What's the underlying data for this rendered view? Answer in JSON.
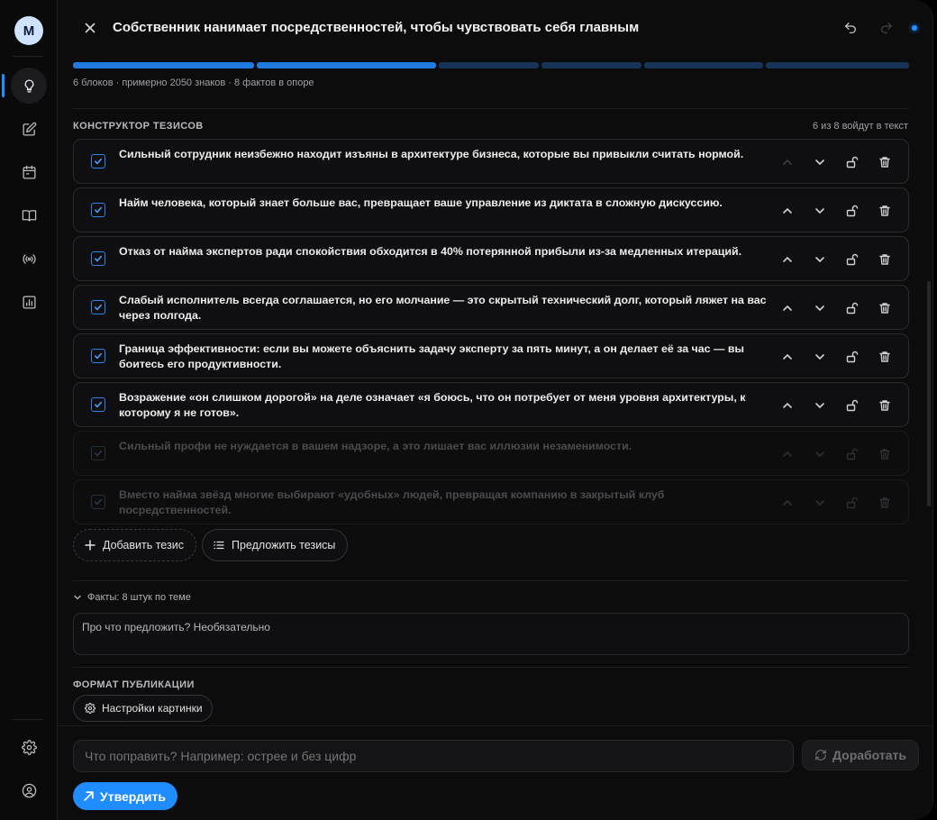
{
  "user": {
    "avatar_letter": "M"
  },
  "rail": {
    "items": [
      {
        "name": "ideas",
        "icon": "lightbulb-icon",
        "active": true
      },
      {
        "name": "editor",
        "icon": "pencil-square-icon",
        "active": false
      },
      {
        "name": "calendar",
        "icon": "calendar-icon",
        "active": false
      },
      {
        "name": "library",
        "icon": "book-icon",
        "active": false
      },
      {
        "name": "broadcast",
        "icon": "broadcast-icon",
        "active": false
      },
      {
        "name": "analytics",
        "icon": "bar-chart-icon",
        "active": false
      }
    ],
    "bottom": [
      {
        "name": "settings",
        "icon": "gear-icon"
      },
      {
        "name": "profile",
        "icon": "user-circle-icon"
      }
    ]
  },
  "header": {
    "title": "Собственник нанимает посредственностей, чтобы чувствовать себя главным",
    "accent_color": "#1e90ff"
  },
  "progress": {
    "segments": [
      {
        "status": "done"
      },
      {
        "status": "done"
      },
      {
        "status": "pending"
      },
      {
        "status": "pending"
      },
      {
        "status": "pending"
      },
      {
        "status": "pending"
      }
    ],
    "summary": "6 блоков · примерно 2050 знаков · 8 фактов в опоре"
  },
  "constructor": {
    "label": "КОНСТРУКТОР ТЕЗИСОВ",
    "counter": "6 из 8 войдут в текст",
    "theses": [
      {
        "text": "Сильный сотрудник неизбежно находит изъяны в архитектуре бизнеса, которые вы привыкли считать нормой.",
        "checked": true,
        "up_enabled": false
      },
      {
        "text": "Найм человека, который знает больше вас, превращает ваше управление из диктата в сложную дискуссию.",
        "checked": true,
        "up_enabled": true
      },
      {
        "text": "Отказ от найма экспертов ради спокойствия обходится в 40% потерянной прибыли из-за медленных итераций.",
        "checked": true,
        "up_enabled": true
      },
      {
        "text": "Слабый исполнитель всегда соглашается, но его молчание — это скрытый технический долг, который ляжет на вас через полгода.",
        "checked": true,
        "up_enabled": true
      },
      {
        "text": "Граница эффективности: если вы можете объяснить задачу эксперту за пять минут, а он делает её за час — вы боитесь его продуктивности.",
        "checked": true,
        "up_enabled": true
      },
      {
        "text": "Возражение «он слишком дорогой» на деле означает «я боюсь, что он потребует от меня уровня архитектуры, к которому я не готов».",
        "checked": true,
        "up_enabled": true
      },
      {
        "text": "Сильный профи не нуждается в вашем надзоре, а это лишает вас иллюзии незаменимости.",
        "checked": false,
        "up_enabled": true
      },
      {
        "text": "Вместо найма звёзд многие выбирают «удобных» людей, превращая компанию в закрытый клуб посредственностей.",
        "checked": false,
        "up_enabled": true
      }
    ],
    "add_label": "Добавить тезис",
    "suggest_label": "Предложить тезисы"
  },
  "facts": {
    "toggle_label": "Факты: 8 штук по теме",
    "placeholder": "Про что предложить? Необязательно"
  },
  "format": {
    "label": "ФОРМАТ ПУБЛИКАЦИИ",
    "settings_label": "Настройки картинки"
  },
  "composer": {
    "placeholder": "Что поправить? Например: острее и без цифр",
    "refine_label": "Доработать",
    "approve_label": "Утвердить"
  }
}
